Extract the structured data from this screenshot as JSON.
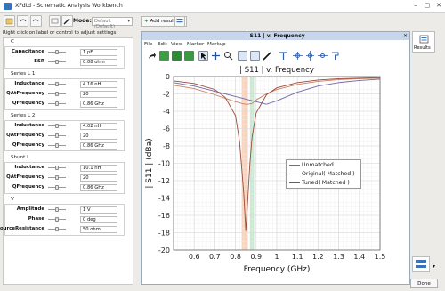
{
  "window": {
    "title": "XFdtd - Schematic Analysis Workbench"
  },
  "toolbar": {
    "mode_label": "Mode:",
    "mode_value": "Default (Default)",
    "add_results_label": "Add results"
  },
  "hint": "Right click on label or control to adjust settings.",
  "sections": [
    {
      "title": "C",
      "params": [
        {
          "label": "Capacitance",
          "value": "1 pF"
        },
        {
          "label": "ESR",
          "value": "0.08 ohm"
        }
      ]
    },
    {
      "title": "Series L 1",
      "params": [
        {
          "label": "Inductance",
          "value": "4.16 nH"
        },
        {
          "label": "QAtFrequency",
          "value": "20"
        },
        {
          "label": "QFrequency",
          "value": "0.86 GHz"
        }
      ]
    },
    {
      "title": "Series L 2",
      "params": [
        {
          "label": "Inductance",
          "value": "4.02 nH"
        },
        {
          "label": "QAtFrequency",
          "value": "20"
        },
        {
          "label": "QFrequency",
          "value": "0.86 GHz"
        }
      ]
    },
    {
      "title": "Shunt L",
      "params": [
        {
          "label": "Inductance",
          "value": "10.1 nH"
        },
        {
          "label": "QAtFrequency",
          "value": "20"
        },
        {
          "label": "QFrequency",
          "value": "0.86 GHz"
        }
      ]
    },
    {
      "title": "V",
      "params": [
        {
          "label": "Amplitude",
          "value": "1 V"
        },
        {
          "label": "Phase",
          "value": "0 deg"
        },
        {
          "label": "SourceResistance",
          "value": "50 ohm"
        }
      ]
    }
  ],
  "plot_window": {
    "title": "| S11 | v. Frequency",
    "menu": [
      "File",
      "Edit",
      "View",
      "Marker",
      "Markup"
    ]
  },
  "right_panel": {
    "results_label": "Results"
  },
  "done_label": "Done",
  "colors": {
    "unmatched": "#6f6aa8",
    "original": "#c9805d",
    "tuned": "#9c4a3c",
    "band_orange": "#f6c9ad",
    "band_green": "#b9e3c6"
  },
  "chart_data": {
    "type": "line",
    "title": "| S11 | v. Frequency",
    "xlabel": "Frequency (GHz)",
    "ylabel": "| S11 | (dBa)",
    "xlim": [
      0.5,
      1.5
    ],
    "ylim": [
      -20,
      0
    ],
    "xticks": [
      0.6,
      0.7,
      0.8,
      0.9,
      1,
      1.1,
      1.2,
      1.3,
      1.4,
      1.5
    ],
    "yticks": [
      0,
      -2,
      -4,
      -6,
      -8,
      -10,
      -12,
      -14,
      -16,
      -18,
      -20
    ],
    "grid": true,
    "legend_position": "right",
    "bands": [
      {
        "from": 0.83,
        "to": 0.86
      },
      {
        "from": 0.87,
        "to": 0.89
      }
    ],
    "series": [
      {
        "name": "Unmatched",
        "x": [
          0.5,
          0.6,
          0.7,
          0.8,
          0.9,
          0.95,
          1.0,
          1.1,
          1.2,
          1.3,
          1.4,
          1.5
        ],
        "y": [
          -0.7,
          -1.1,
          -1.7,
          -2.3,
          -2.9,
          -3.2,
          -2.8,
          -1.8,
          -1.1,
          -0.7,
          -0.45,
          -0.3
        ]
      },
      {
        "name": "Original( Matched )",
        "x": [
          0.5,
          0.6,
          0.7,
          0.75,
          0.8,
          0.83,
          0.85,
          0.86,
          0.88,
          0.9,
          0.95,
          1.0,
          1.1,
          1.2,
          1.3,
          1.4,
          1.5
        ],
        "y": [
          -1.0,
          -1.4,
          -2.1,
          -2.5,
          -2.9,
          -3.1,
          -3.2,
          -3.2,
          -3.1,
          -2.7,
          -2.0,
          -1.5,
          -0.9,
          -0.55,
          -0.35,
          -0.25,
          -0.2
        ]
      },
      {
        "name": "Tuned( Matched )",
        "x": [
          0.5,
          0.6,
          0.7,
          0.75,
          0.8,
          0.82,
          0.84,
          0.85,
          0.86,
          0.87,
          0.88,
          0.9,
          0.95,
          1.0,
          1.1,
          1.2,
          1.3,
          1.4,
          1.5
        ],
        "y": [
          -0.5,
          -0.8,
          -1.5,
          -2.4,
          -4.5,
          -7.5,
          -13.5,
          -17.8,
          -14,
          -10,
          -7,
          -4.2,
          -2.1,
          -1.3,
          -0.7,
          -0.4,
          -0.25,
          -0.18,
          -0.12
        ]
      }
    ]
  }
}
